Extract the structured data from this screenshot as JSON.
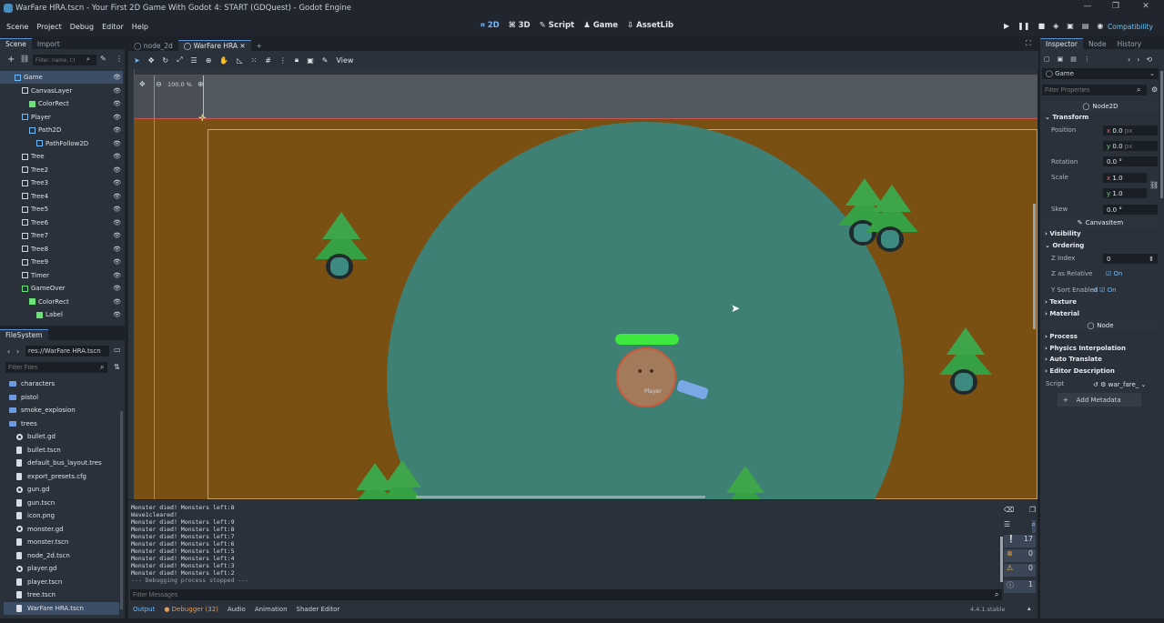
{
  "window": {
    "title": "WarFare HRA.tscn - Your First 2D Game With Godot 4: START (GDQuest) - Godot Engine"
  },
  "menu": [
    "Scene",
    "Project",
    "Debug",
    "Editor",
    "Help"
  ],
  "workspaces": [
    "2D",
    "3D",
    "Script",
    "Game",
    "AssetLib"
  ],
  "renderer": "Compatibility",
  "scene_dock": {
    "tabs": [
      "Scene",
      "Import"
    ],
    "filter_placeholder": "Filter: name, t:t",
    "nodes": [
      {
        "name": "Game",
        "depth": 0
      },
      {
        "name": "CanvasLayer",
        "depth": 1
      },
      {
        "name": "ColorRect",
        "depth": 2
      },
      {
        "name": "Player",
        "depth": 1
      },
      {
        "name": "Path2D",
        "depth": 2
      },
      {
        "name": "PathFollow2D",
        "depth": 3
      },
      {
        "name": "Tree",
        "depth": 1
      },
      {
        "name": "Tree2",
        "depth": 1
      },
      {
        "name": "Tree3",
        "depth": 1
      },
      {
        "name": "Tree4",
        "depth": 1
      },
      {
        "name": "Tree5",
        "depth": 1
      },
      {
        "name": "Tree6",
        "depth": 1
      },
      {
        "name": "Tree7",
        "depth": 1
      },
      {
        "name": "Tree8",
        "depth": 1
      },
      {
        "name": "Tree9",
        "depth": 1
      },
      {
        "name": "Timer",
        "depth": 1
      },
      {
        "name": "GameOver",
        "depth": 1
      },
      {
        "name": "ColorRect",
        "depth": 2
      },
      {
        "name": "Label",
        "depth": 3
      }
    ]
  },
  "filesystem": {
    "title": "FileSystem",
    "path": "res://WarFare HRA.tscn",
    "filter_placeholder": "Filter Files",
    "items": [
      {
        "name": "characters",
        "kind": "folder"
      },
      {
        "name": "pistol",
        "kind": "folder"
      },
      {
        "name": "smoke_explosion",
        "kind": "folder"
      },
      {
        "name": "trees",
        "kind": "folder"
      },
      {
        "name": "bullet.gd",
        "kind": "script"
      },
      {
        "name": "bullet.tscn",
        "kind": "file"
      },
      {
        "name": "default_bus_layout.tres",
        "kind": "file"
      },
      {
        "name": "export_presets.cfg",
        "kind": "file"
      },
      {
        "name": "gun.gd",
        "kind": "script"
      },
      {
        "name": "gun.tscn",
        "kind": "file"
      },
      {
        "name": "icon.png",
        "kind": "file"
      },
      {
        "name": "monster.gd",
        "kind": "script"
      },
      {
        "name": "monster.tscn",
        "kind": "file"
      },
      {
        "name": "node_2d.tscn",
        "kind": "file"
      },
      {
        "name": "player.gd",
        "kind": "script"
      },
      {
        "name": "player.tscn",
        "kind": "file"
      },
      {
        "name": "tree.tscn",
        "kind": "file"
      },
      {
        "name": "WarFare HRA.tscn",
        "kind": "file",
        "selected": true
      }
    ]
  },
  "editor_tabs": [
    "node_2d",
    "WarFare HRA"
  ],
  "viewport": {
    "zoom": "100.0 %",
    "view_label": "View",
    "player_label": "Player"
  },
  "output": {
    "lines": [
      "Monster died! Monsters left:8",
      "Wave1cleared!",
      "Monster died! Monsters left:9",
      "Monster died! Monsters left:8",
      "Monster died! Monsters left:7",
      "Monster died! Monsters left:6",
      "Monster died! Monsters left:5",
      "Monster died! Monsters left:4",
      "Monster died! Monsters left:3",
      "Monster died! Monsters left:2",
      "--- Debugging process stopped ---"
    ],
    "filter_placeholder": "Filter Messages",
    "counters": {
      "messages": "17",
      "errors": "0",
      "warnings": "0",
      "info": "1"
    }
  },
  "bottom_tabs": [
    "Output",
    "Debugger (32)",
    "Audio",
    "Animation",
    "Shader Editor"
  ],
  "version": "4.4.1.stable",
  "inspector": {
    "tabs": [
      "Inspector",
      "Node",
      "History"
    ],
    "object": "Game",
    "filter_placeholder": "Filter Properties",
    "node2d_header": "Node2D",
    "transform_label": "Transform",
    "position_label": "Position",
    "pos_x": "0.0",
    "pos_y": "0.0",
    "px": "px",
    "rotation_label": "Rotation",
    "rotation": "0.0 °",
    "scale_label": "Scale",
    "scale_x": "1.0",
    "scale_y": "1.0",
    "skew_label": "Skew",
    "skew": "0.0 °",
    "canvasitem_header": "CanvasItem",
    "visibility": "Visibility",
    "ordering": "Ordering",
    "zindex_label": "Z Index",
    "zindex": "0",
    "zrel_label": "Z as Relative",
    "zrel": "On",
    "ysort_label": "Y Sort Enabled",
    "ysort": "On",
    "texture": "Texture",
    "material": "Material",
    "node_header": "Node",
    "process": "Process",
    "physics": "Physics Interpolation",
    "autotranslate": "Auto Translate",
    "editor_desc": "Editor Description",
    "script_label": "Script",
    "script_value": "war_fare_",
    "add_metadata": "Add Metadata"
  },
  "colors": {
    "accent": "#70bafa",
    "ground": "#7a4f12",
    "circle": "#3f8075",
    "health": "#3ee83e"
  }
}
